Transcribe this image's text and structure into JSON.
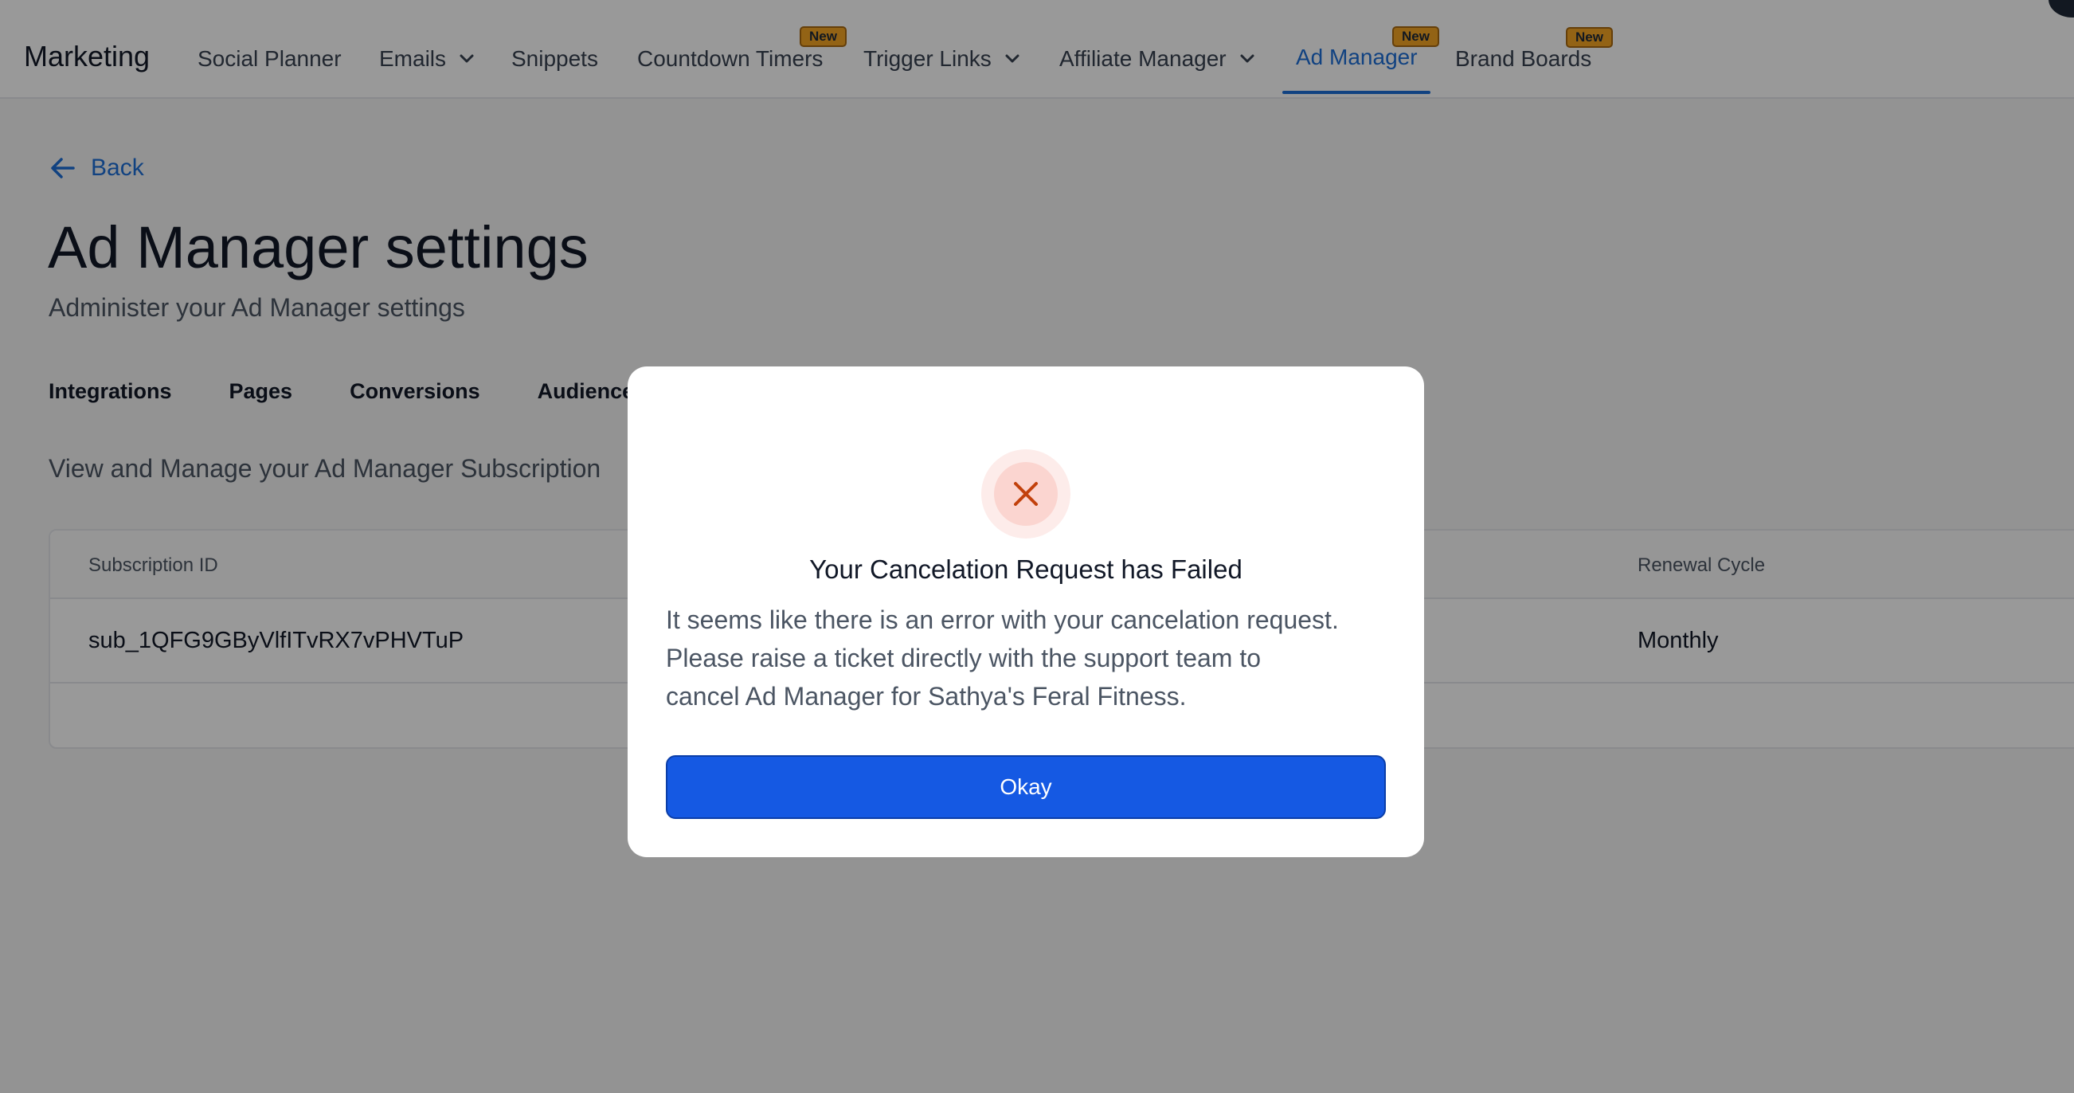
{
  "nav": {
    "brand": "Marketing",
    "items": [
      {
        "label": "Social Planner"
      },
      {
        "label": "Emails"
      },
      {
        "label": "Snippets"
      },
      {
        "label": "Countdown Timers",
        "badge": "New"
      },
      {
        "label": "Trigger Links"
      },
      {
        "label": "Affiliate Manager"
      },
      {
        "label": "Ad Manager",
        "badge": "New"
      },
      {
        "label": "Brand Boards",
        "badge": "New"
      }
    ],
    "active": "Ad Manager"
  },
  "back": {
    "label": "Back"
  },
  "page": {
    "title": "Ad Manager settings",
    "subtitle": "Administer your Ad Manager settings"
  },
  "tabs": [
    {
      "label": "Integrations"
    },
    {
      "label": "Pages"
    },
    {
      "label": "Conversions"
    },
    {
      "label": "Audiences"
    }
  ],
  "section": {
    "description": "View and Manage your Ad Manager Subscription"
  },
  "table": {
    "columns": [
      "Subscription ID",
      "Renewal Cycle"
    ],
    "rows": [
      {
        "subscription_id": "sub_1QFG9GByVlfITvRX7vPHVTuP",
        "renewal_cycle": "Monthly"
      }
    ]
  },
  "modal": {
    "title": "Your Cancelation Request has Failed",
    "body_lines": [
      "It seems like there is an error with your cancelation request.",
      "Please raise a ticket directly with the support team to",
      "cancel Ad Manager for Sathya's Feral Fitness."
    ],
    "button": "Okay",
    "icon": "close-icon"
  },
  "colors": {
    "accent": "#1d6fd8",
    "button": "#1559e3",
    "badge": "#f5a623",
    "error_icon": "#c2410c"
  }
}
